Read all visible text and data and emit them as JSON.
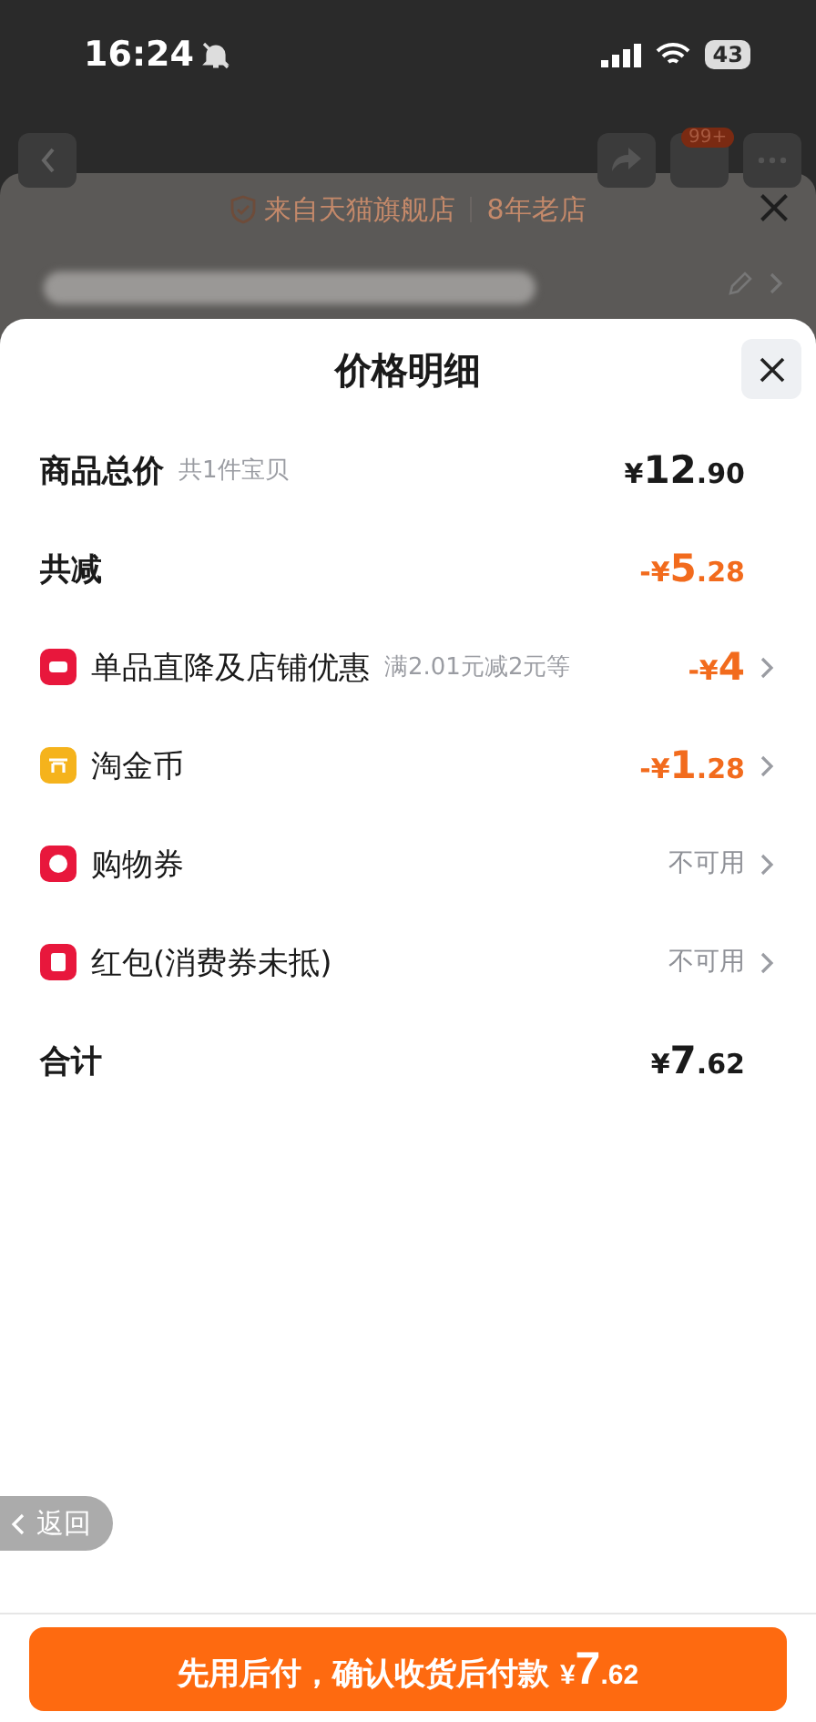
{
  "status_bar": {
    "time": "16:24",
    "battery": "43"
  },
  "background_page": {
    "cart_badge": "99+"
  },
  "store_sheet": {
    "store_label": "来自天猫旗舰店",
    "store_age": "8年老店"
  },
  "price_sheet": {
    "title": "价格明细",
    "rows": [
      {
        "kind": "summary",
        "label": "商品总价",
        "note": "共1件宝贝",
        "price": {
          "prefix": "¥",
          "main": "12",
          "fraction": ".90",
          "highlight": false
        }
      },
      {
        "kind": "summary",
        "label": "共减",
        "price": {
          "prefix": "-¥",
          "main": "5",
          "fraction": ".28",
          "highlight": true
        }
      },
      {
        "kind": "discount",
        "color": "#e8173c",
        "label": "单品直降及店铺优惠",
        "note": "满2.01元减2元等",
        "price": {
          "prefix": "-¥",
          "main": "4",
          "highlight": true
        }
      },
      {
        "kind": "discount",
        "color": "#f5b31c",
        "label": "淘金币",
        "price": {
          "prefix": "-¥",
          "main": "1",
          "fraction": ".28",
          "highlight": true
        }
      },
      {
        "kind": "discount",
        "color": "#e8173c",
        "label": "购物券",
        "status": "不可用"
      },
      {
        "kind": "discount",
        "color": "#e8173c",
        "label": "红包(消费券未抵)",
        "status": "不可用"
      },
      {
        "kind": "summary",
        "label": "合计",
        "price": {
          "prefix": "¥",
          "main": "7",
          "fraction": ".62",
          "highlight": false
        }
      }
    ]
  },
  "back_button": {
    "label": "返回"
  },
  "pay_button": {
    "label": "先用后付，确认收货后付款",
    "price": {
      "prefix": "¥",
      "main": "7",
      "fraction": ".62"
    }
  }
}
